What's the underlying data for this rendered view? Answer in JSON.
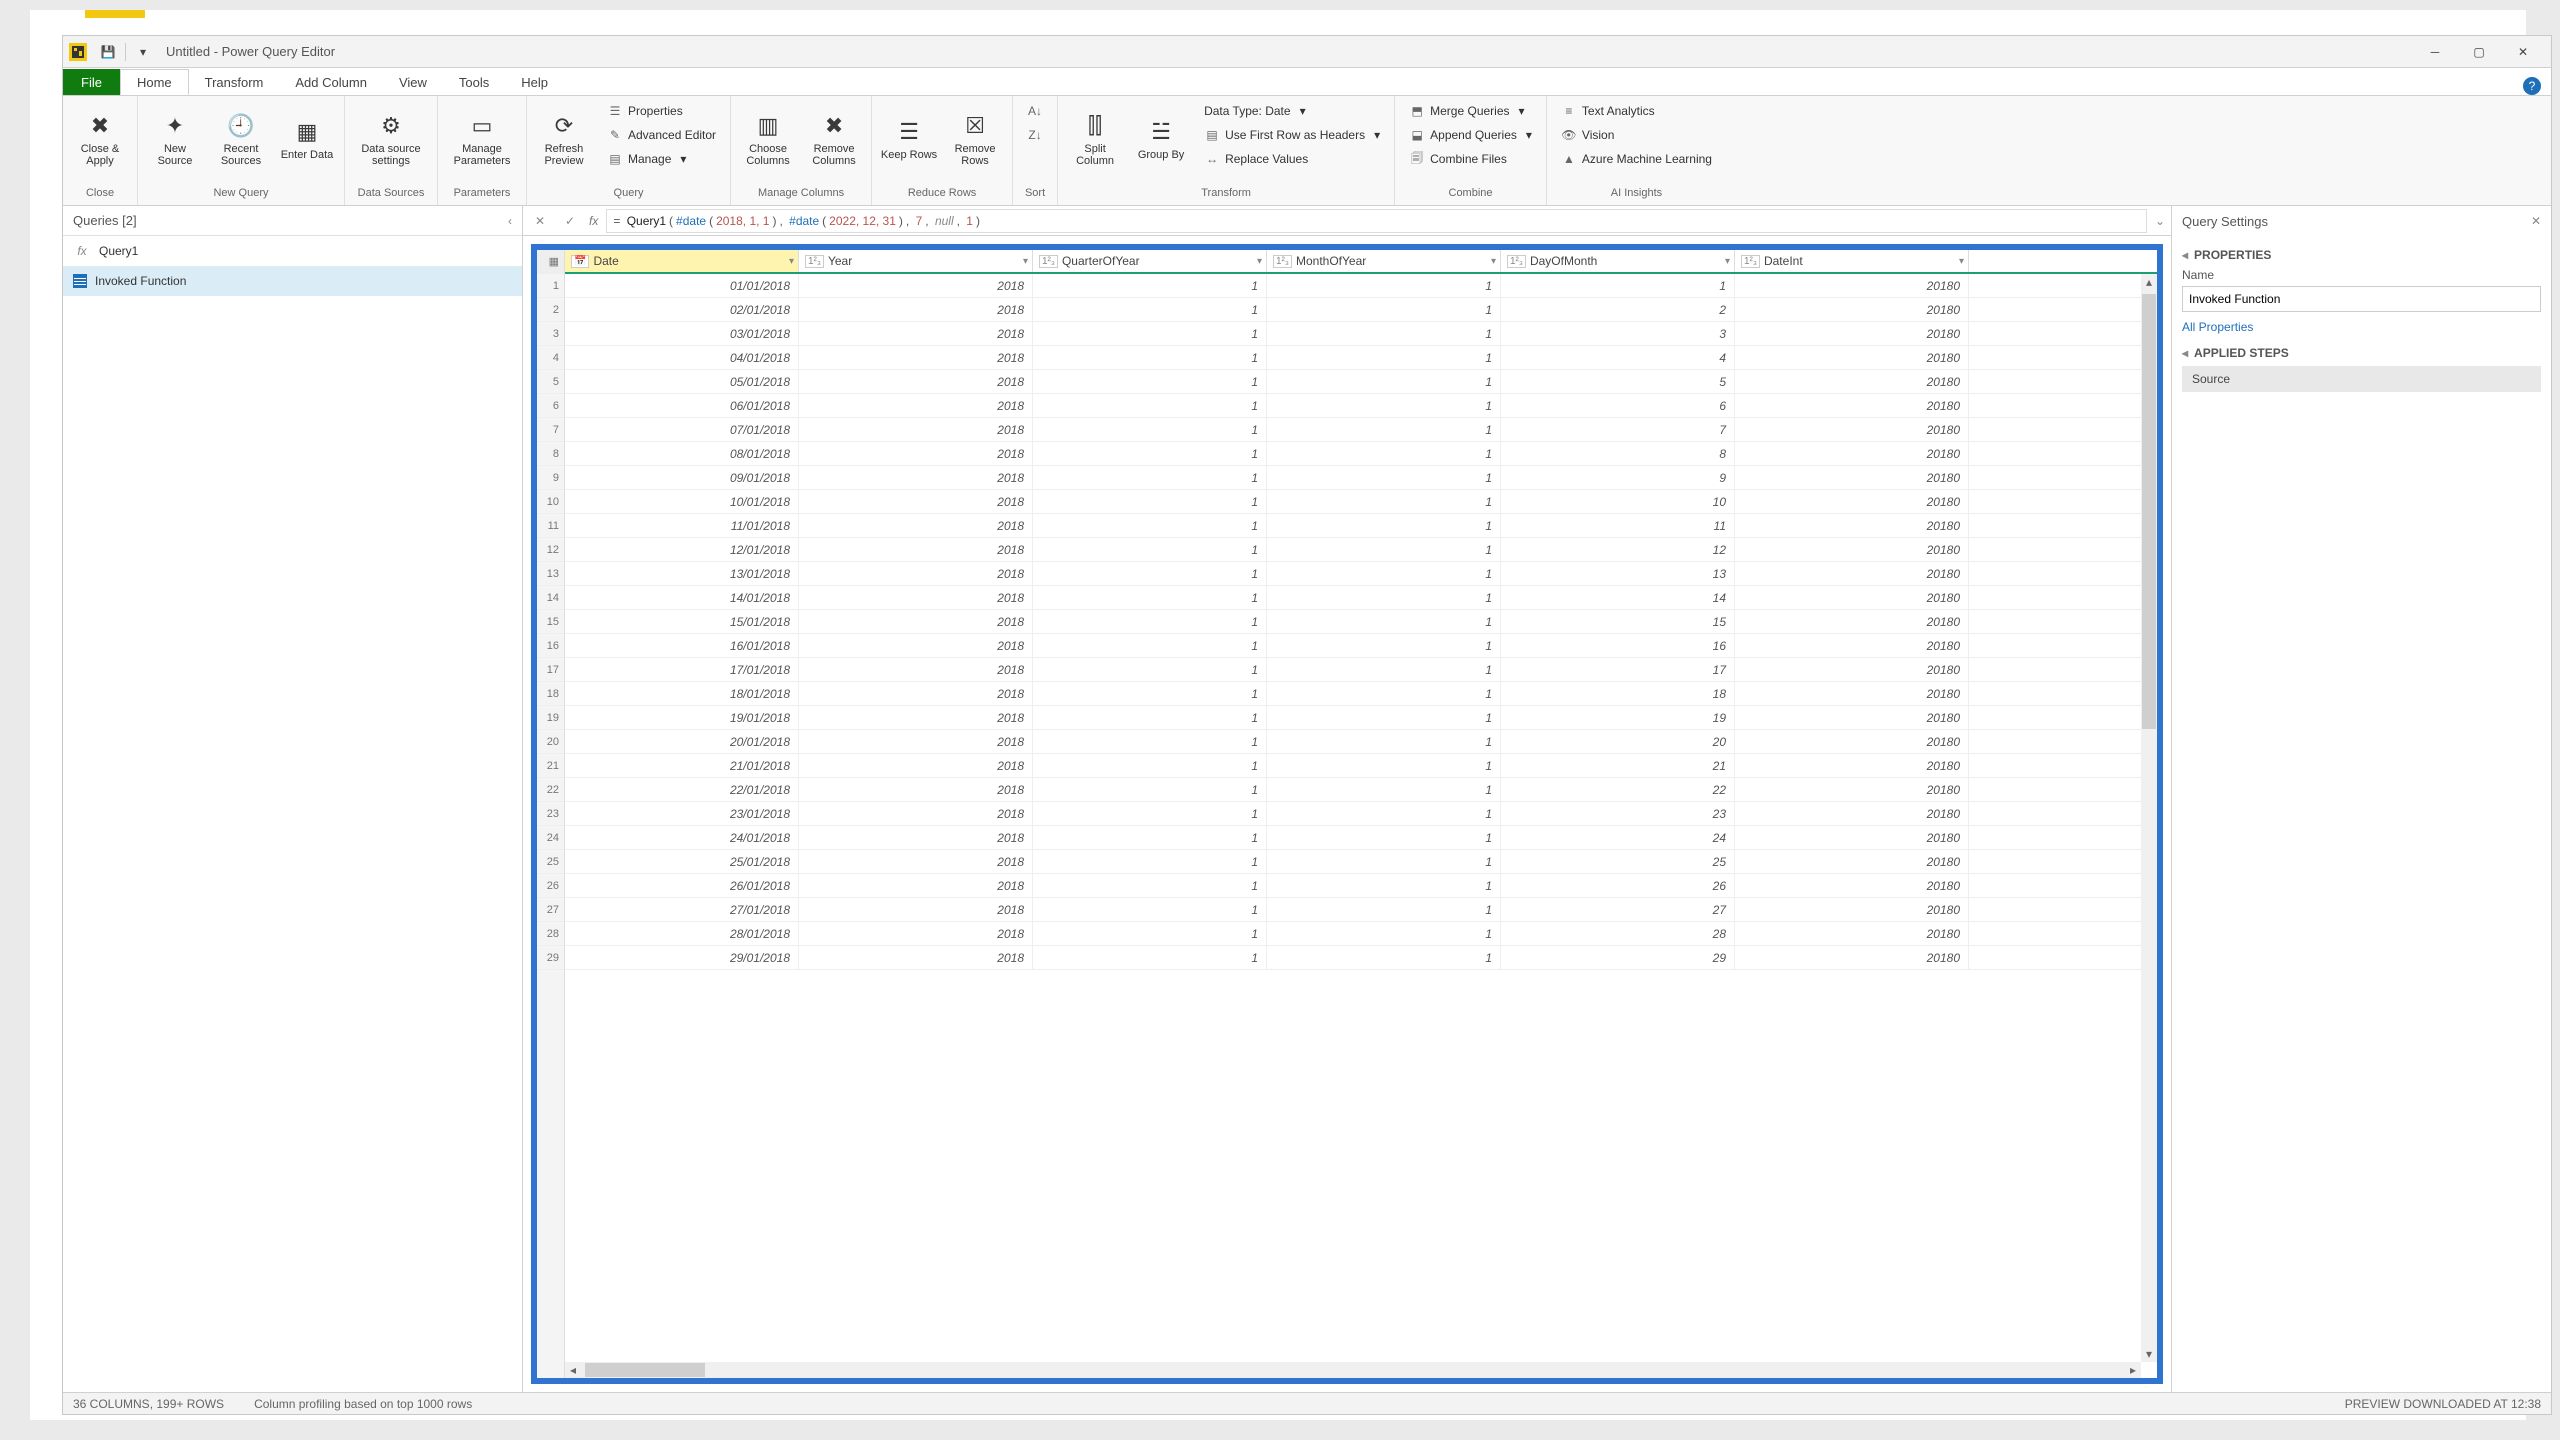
{
  "window": {
    "title": "Untitled - Power Query Editor"
  },
  "menutabs": {
    "file": "File",
    "home": "Home",
    "transform": "Transform",
    "add": "Add Column",
    "view": "View",
    "tools": "Tools",
    "help": "Help"
  },
  "ribbon": {
    "close": {
      "btn": "Close &\nApply",
      "cap": "Close"
    },
    "newquery": {
      "new": "New\nSource",
      "recent": "Recent\nSources",
      "enter": "Enter\nData",
      "cap": "New Query"
    },
    "ds": {
      "btn": "Data source\nsettings",
      "cap": "Data Sources"
    },
    "params": {
      "btn": "Manage\nParameters",
      "cap": "Parameters"
    },
    "query": {
      "refresh": "Refresh\nPreview",
      "props": "Properties",
      "adv": "Advanced Editor",
      "manage": "Manage",
      "cap": "Query"
    },
    "mcols": {
      "choose": "Choose\nColumns",
      "remove": "Remove\nColumns",
      "cap": "Manage Columns"
    },
    "rrows": {
      "keep": "Keep\nRows",
      "remove": "Remove\nRows",
      "cap": "Reduce Rows"
    },
    "sort": {
      "cap": "Sort"
    },
    "transform": {
      "split": "Split\nColumn",
      "group": "Group\nBy",
      "dt": "Data Type: Date",
      "first": "Use First Row as Headers",
      "replace": "Replace Values",
      "cap": "Transform"
    },
    "combine": {
      "merge": "Merge Queries",
      "append": "Append Queries",
      "files": "Combine Files",
      "cap": "Combine"
    },
    "ai": {
      "text": "Text Analytics",
      "vision": "Vision",
      "ml": "Azure Machine Learning",
      "cap": "AI Insights"
    }
  },
  "queries": {
    "title": "Queries [2]",
    "q1": "Query1",
    "q2": "Invoked Function"
  },
  "formula": {
    "prefix": "= Query1(",
    "d1a": "#date",
    "d1n": "2018, 1, 1",
    "d2a": "#date",
    "d2n": "2022, 12, 31",
    "rest": "7, null, 1"
  },
  "columns": {
    "date": "Date",
    "year": "Year",
    "q": "QuarterOfYear",
    "m": "MonthOfYear",
    "d": "DayOfMonth",
    "i": "DateInt",
    "typetext": "1²₃"
  },
  "rows": [
    {
      "n": "1",
      "date": "01/01/2018",
      "year": "2018",
      "q": "1",
      "m": "1",
      "d": "1",
      "i": "20180"
    },
    {
      "n": "2",
      "date": "02/01/2018",
      "year": "2018",
      "q": "1",
      "m": "1",
      "d": "2",
      "i": "20180"
    },
    {
      "n": "3",
      "date": "03/01/2018",
      "year": "2018",
      "q": "1",
      "m": "1",
      "d": "3",
      "i": "20180"
    },
    {
      "n": "4",
      "date": "04/01/2018",
      "year": "2018",
      "q": "1",
      "m": "1",
      "d": "4",
      "i": "20180"
    },
    {
      "n": "5",
      "date": "05/01/2018",
      "year": "2018",
      "q": "1",
      "m": "1",
      "d": "5",
      "i": "20180"
    },
    {
      "n": "6",
      "date": "06/01/2018",
      "year": "2018",
      "q": "1",
      "m": "1",
      "d": "6",
      "i": "20180"
    },
    {
      "n": "7",
      "date": "07/01/2018",
      "year": "2018",
      "q": "1",
      "m": "1",
      "d": "7",
      "i": "20180"
    },
    {
      "n": "8",
      "date": "08/01/2018",
      "year": "2018",
      "q": "1",
      "m": "1",
      "d": "8",
      "i": "20180"
    },
    {
      "n": "9",
      "date": "09/01/2018",
      "year": "2018",
      "q": "1",
      "m": "1",
      "d": "9",
      "i": "20180"
    },
    {
      "n": "10",
      "date": "10/01/2018",
      "year": "2018",
      "q": "1",
      "m": "1",
      "d": "10",
      "i": "20180"
    },
    {
      "n": "11",
      "date": "11/01/2018",
      "year": "2018",
      "q": "1",
      "m": "1",
      "d": "11",
      "i": "20180"
    },
    {
      "n": "12",
      "date": "12/01/2018",
      "year": "2018",
      "q": "1",
      "m": "1",
      "d": "12",
      "i": "20180"
    },
    {
      "n": "13",
      "date": "13/01/2018",
      "year": "2018",
      "q": "1",
      "m": "1",
      "d": "13",
      "i": "20180"
    },
    {
      "n": "14",
      "date": "14/01/2018",
      "year": "2018",
      "q": "1",
      "m": "1",
      "d": "14",
      "i": "20180"
    },
    {
      "n": "15",
      "date": "15/01/2018",
      "year": "2018",
      "q": "1",
      "m": "1",
      "d": "15",
      "i": "20180"
    },
    {
      "n": "16",
      "date": "16/01/2018",
      "year": "2018",
      "q": "1",
      "m": "1",
      "d": "16",
      "i": "20180"
    },
    {
      "n": "17",
      "date": "17/01/2018",
      "year": "2018",
      "q": "1",
      "m": "1",
      "d": "17",
      "i": "20180"
    },
    {
      "n": "18",
      "date": "18/01/2018",
      "year": "2018",
      "q": "1",
      "m": "1",
      "d": "18",
      "i": "20180"
    },
    {
      "n": "19",
      "date": "19/01/2018",
      "year": "2018",
      "q": "1",
      "m": "1",
      "d": "19",
      "i": "20180"
    },
    {
      "n": "20",
      "date": "20/01/2018",
      "year": "2018",
      "q": "1",
      "m": "1",
      "d": "20",
      "i": "20180"
    },
    {
      "n": "21",
      "date": "21/01/2018",
      "year": "2018",
      "q": "1",
      "m": "1",
      "d": "21",
      "i": "20180"
    },
    {
      "n": "22",
      "date": "22/01/2018",
      "year": "2018",
      "q": "1",
      "m": "1",
      "d": "22",
      "i": "20180"
    },
    {
      "n": "23",
      "date": "23/01/2018",
      "year": "2018",
      "q": "1",
      "m": "1",
      "d": "23",
      "i": "20180"
    },
    {
      "n": "24",
      "date": "24/01/2018",
      "year": "2018",
      "q": "1",
      "m": "1",
      "d": "24",
      "i": "20180"
    },
    {
      "n": "25",
      "date": "25/01/2018",
      "year": "2018",
      "q": "1",
      "m": "1",
      "d": "25",
      "i": "20180"
    },
    {
      "n": "26",
      "date": "26/01/2018",
      "year": "2018",
      "q": "1",
      "m": "1",
      "d": "26",
      "i": "20180"
    },
    {
      "n": "27",
      "date": "27/01/2018",
      "year": "2018",
      "q": "1",
      "m": "1",
      "d": "27",
      "i": "20180"
    },
    {
      "n": "28",
      "date": "28/01/2018",
      "year": "2018",
      "q": "1",
      "m": "1",
      "d": "28",
      "i": "20180"
    },
    {
      "n": "29",
      "date": "29/01/2018",
      "year": "2018",
      "q": "1",
      "m": "1",
      "d": "29",
      "i": "20180"
    }
  ],
  "settings": {
    "title": "Query Settings",
    "props": "PROPERTIES",
    "name_lbl": "Name",
    "name_val": "Invoked Function",
    "all": "All Properties",
    "steps": "APPLIED STEPS",
    "step1": "Source"
  },
  "status": {
    "left1": "36 COLUMNS, 199+ ROWS",
    "left2": "Column profiling based on top 1000 rows",
    "right": "PREVIEW DOWNLOADED AT 12:38"
  }
}
